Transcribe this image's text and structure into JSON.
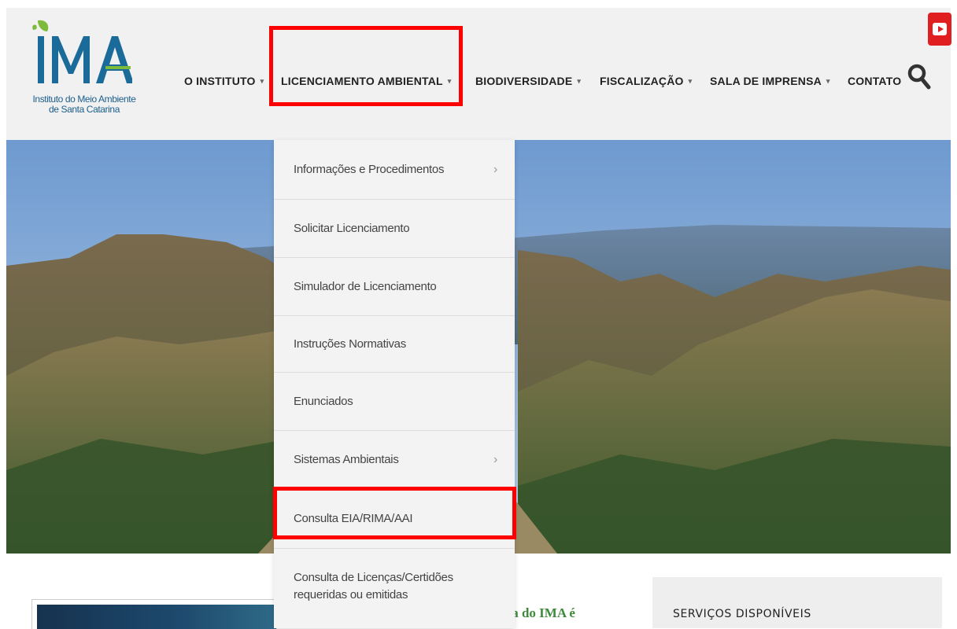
{
  "logo": {
    "text": "IMA",
    "subtitle_line1": "Instituto do Meio Ambiente",
    "subtitle_line2": "de Santa Catarina"
  },
  "nav": {
    "items": [
      {
        "label": "O INSTITUTO",
        "has_dropdown": true
      },
      {
        "label": "LICENCIAMENTO AMBIENTAL",
        "has_dropdown": true
      },
      {
        "label": "BIODIVERSIDADE",
        "has_dropdown": true
      },
      {
        "label": "FISCALIZAÇÃO",
        "has_dropdown": true
      },
      {
        "label": "SALA DE IMPRENSA",
        "has_dropdown": true
      },
      {
        "label": "CONTATO",
        "has_dropdown": false
      }
    ],
    "caret": "▾"
  },
  "dropdown": {
    "items": [
      {
        "label": "Informações e Procedimentos",
        "submenu": true
      },
      {
        "label": "Solicitar Licenciamento",
        "submenu": false
      },
      {
        "label": "Simulador de Licenciamento",
        "submenu": false
      },
      {
        "label": "Instruções Normativas",
        "submenu": false
      },
      {
        "label": "Enunciados",
        "submenu": false
      },
      {
        "label": "Sistemas Ambientais",
        "submenu": true
      },
      {
        "label": "Consulta EIA/RIMA/AAI",
        "submenu": false
      },
      {
        "label_line1": "Consulta de Licenças/Certidões",
        "label_line2": "requeridas ou emitidas",
        "submenu": false
      }
    ],
    "chevron": "›"
  },
  "news": {
    "title_partial": "idora do IMA é"
  },
  "services": {
    "title": "SERVIÇOS DISPONÍVEIS"
  },
  "colors": {
    "brand_blue": "#1b5e8c",
    "brand_green": "#7dbb3a",
    "highlight": "#ff0000",
    "youtube": "#e02020",
    "news_green": "#3f8a3c"
  }
}
